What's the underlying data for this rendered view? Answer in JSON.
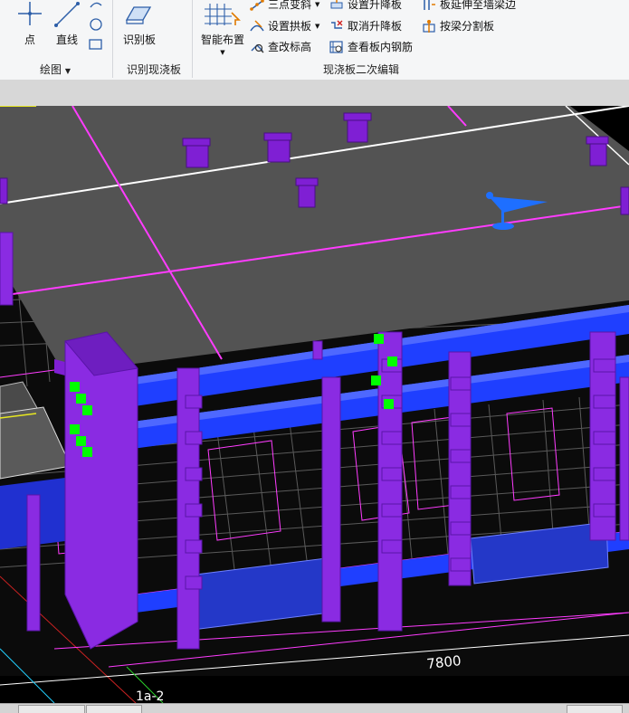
{
  "ribbon": {
    "draw_group": {
      "label": "绘图",
      "point_label": "点",
      "line_label": "直线"
    },
    "identify_group": {
      "label": "识别现浇板",
      "identify_slab_label": "识别板"
    },
    "edit_group": {
      "label": "现浇板二次编辑",
      "smart_layout_label": "智能布置",
      "three_point_slope_label": "三点变斜",
      "set_arch_label": "设置拱板",
      "check_elevation_label": "查改标高",
      "set_raise_lower_label": "设置升降板",
      "cancel_raise_lower_label": "取消升降板",
      "view_rebar_label": "查看板内钢筋",
      "extend_to_beam_label": "板延伸至墙梁边",
      "split_by_beam_label": "按梁分割板"
    }
  },
  "viewport": {
    "dimension_label": "7800",
    "axis_label": "1a-2"
  },
  "colors": {
    "slab": "#505050",
    "column": "#8a2be2",
    "beam": "#1f3fff",
    "grid_line": "#ff3cff",
    "grip": "#00ff00",
    "marker": "#1e6fff"
  }
}
